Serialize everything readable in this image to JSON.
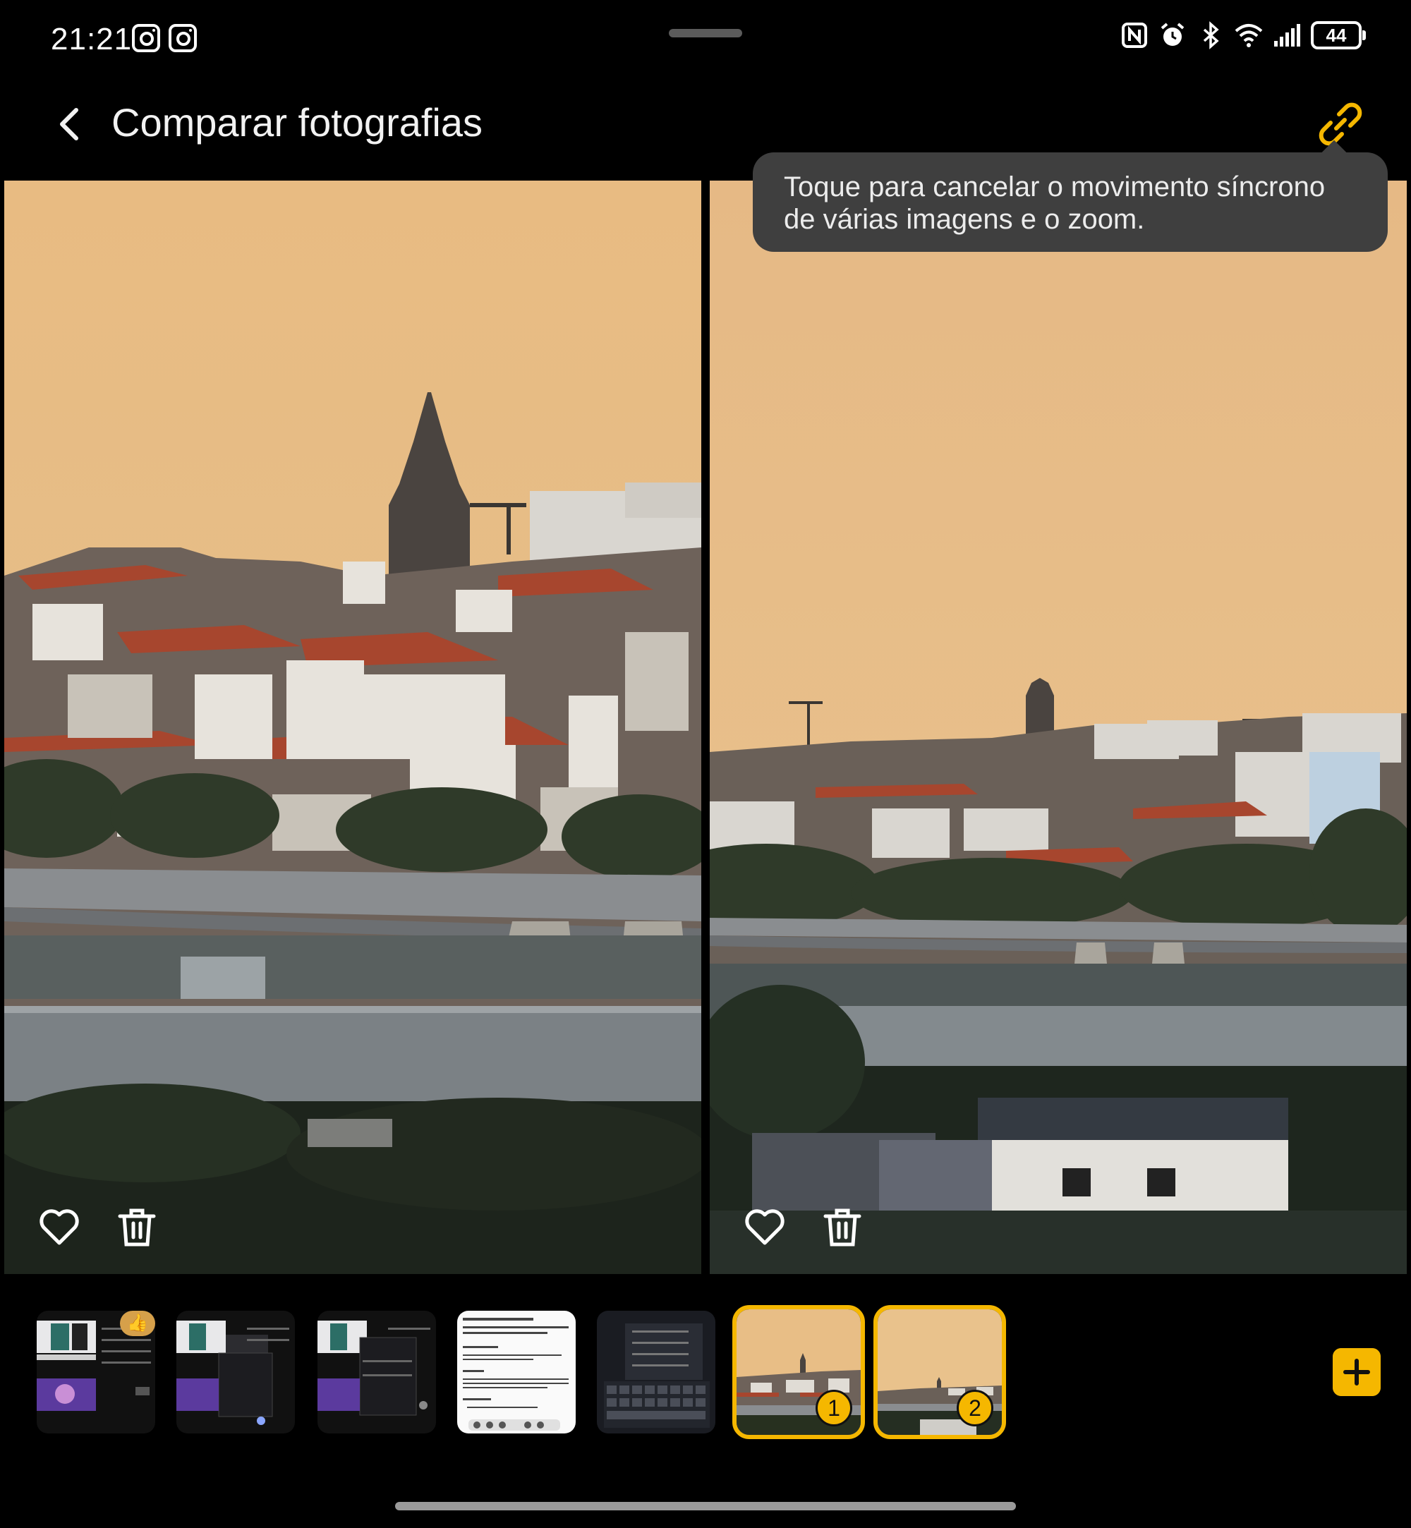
{
  "status_bar": {
    "time": "21:21",
    "app_icons": [
      "instagram-icon",
      "instagram-icon"
    ],
    "system_icons": [
      "nfc-icon",
      "alarm-icon",
      "bluetooth-icon",
      "wifi-icon",
      "signal-icon"
    ],
    "battery": "44"
  },
  "header": {
    "title": "Comparar fotografias",
    "back_icon": "back-arrow-icon",
    "link_icon": "link-icon"
  },
  "tooltip": {
    "text": "Toque para cancelar o movimento síncrono de várias imagens e o zoom."
  },
  "panels": [
    {
      "actions": [
        "heart-icon",
        "trash-icon"
      ]
    },
    {
      "actions": [
        "heart-icon",
        "trash-icon"
      ]
    }
  ],
  "filmstrip": {
    "thumbnails": [
      {
        "kind": "screenshot",
        "selected": false,
        "badge": ""
      },
      {
        "kind": "screenshot",
        "selected": false,
        "badge": ""
      },
      {
        "kind": "screenshot",
        "selected": false,
        "badge": ""
      },
      {
        "kind": "document",
        "selected": false,
        "badge": ""
      },
      {
        "kind": "keyboard-screenshot",
        "selected": false,
        "badge": ""
      },
      {
        "kind": "city-photo",
        "selected": true,
        "badge": "1"
      },
      {
        "kind": "city-photo",
        "selected": true,
        "badge": "2"
      }
    ],
    "add_icon": "plus-icon"
  },
  "colors": {
    "accent": "#f5b700",
    "sky": "#e8bd83",
    "tooltip_bg": "#3f3f3f"
  }
}
